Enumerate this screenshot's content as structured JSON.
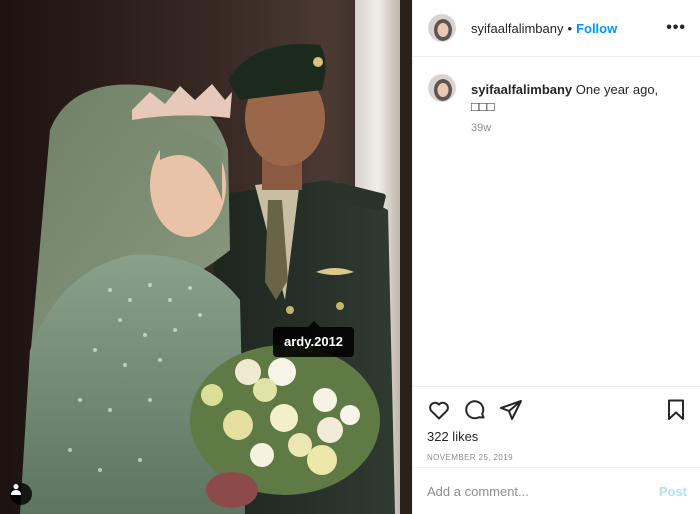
{
  "post": {
    "image_alt": "Wedding photo of a bride in sage green hijab and tiara holding a bouquet beside a groom in green military uniform",
    "tag_label": "ardy.2012"
  },
  "header": {
    "username": "syifaalfalimbany",
    "dot": "•",
    "follow_label": "Follow",
    "more_label": "•••"
  },
  "caption": {
    "username": "syifaalfalimbany",
    "text": "One year ago, □□□",
    "time": "39w"
  },
  "actions": {
    "likes": "322 likes",
    "date": "NOVEMBER 25, 2019"
  },
  "comment": {
    "placeholder": "Add a comment...",
    "post_label": "Post"
  },
  "colors": {
    "follow_blue": "#0095f6",
    "post_disabled": "#b2dffc",
    "secondary_text": "#8e8e8e",
    "divider": "#efefef"
  }
}
